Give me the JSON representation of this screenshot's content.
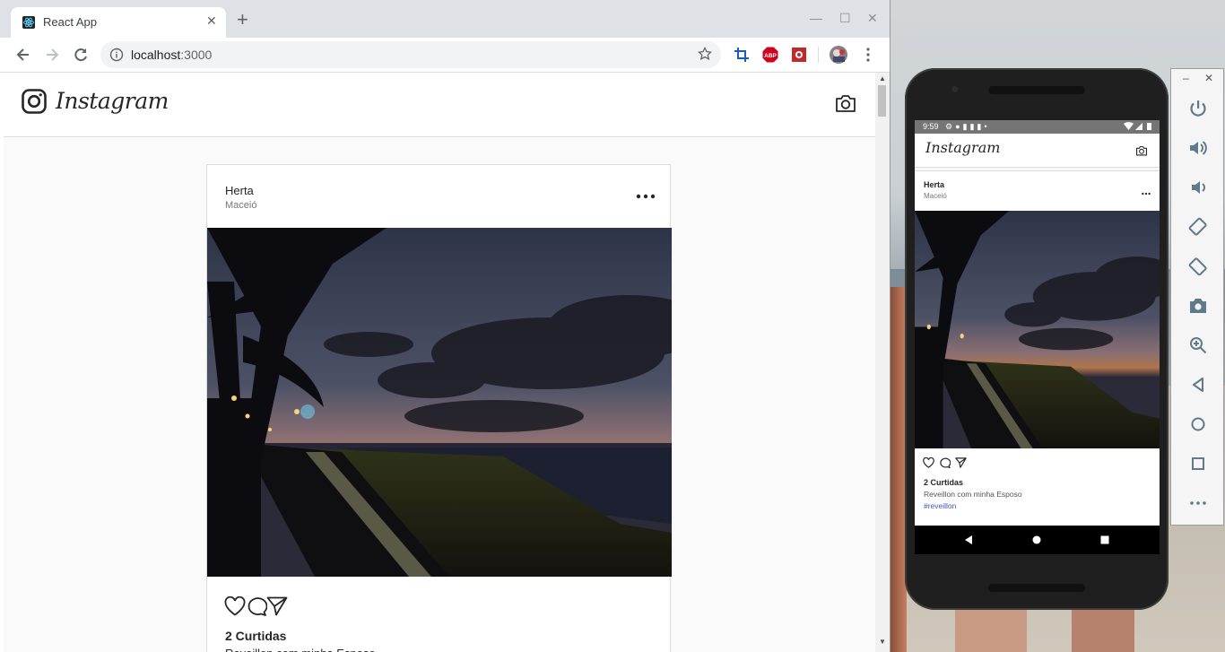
{
  "browser": {
    "tab_title": "React App",
    "url_host": "localhost",
    "url_port": ":3000",
    "window_controls": [
      "minimize-icon",
      "maximize-icon",
      "close-icon"
    ],
    "extensions": [
      {
        "name": "crop-extension-icon",
        "label": ""
      },
      {
        "name": "adblock-plus-icon",
        "label": "ABP"
      },
      {
        "name": "red-extension-icon",
        "label": ""
      },
      {
        "name": "profile-avatar",
        "label": ""
      }
    ]
  },
  "app": {
    "brand": "Instagram",
    "post": {
      "author": "Herta",
      "place": "Maceió",
      "likes": "2 Curtidas",
      "description": "Reveillon com minha Esposo",
      "hashtag": "#reveillon"
    }
  },
  "phone": {
    "time": "9:59"
  },
  "colors": {
    "hashtag": "#4154b8",
    "border": "#dbdbdb",
    "background": "#fafafa"
  }
}
